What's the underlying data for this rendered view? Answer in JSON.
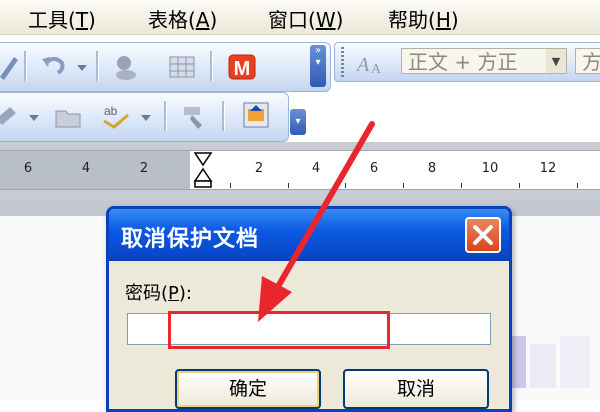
{
  "menubar": {
    "items": [
      {
        "label": "工具",
        "accel": "T"
      },
      {
        "label": "表格",
        "accel": "A"
      },
      {
        "label": "窗口",
        "accel": "W"
      },
      {
        "label": "帮助",
        "accel": "H"
      }
    ]
  },
  "format_toolbar": {
    "style_combo": "正文 + 方正",
    "font_combo": "方"
  },
  "toolbar_icons": {
    "row1": [
      "pen-icon",
      "undo-icon",
      "dropdown-icon",
      "research-icon",
      "table-icon",
      "m-icon"
    ],
    "row2": [
      "drawing-icon",
      "folder-icon",
      "spelling-icon",
      "format-painter-icon",
      "document-map-icon"
    ]
  },
  "ruler": {
    "labels": [
      "6",
      "4",
      "2",
      "2",
      "4",
      "6",
      "8",
      "10",
      "12"
    ]
  },
  "dialog": {
    "title": "取消保护文档",
    "password_label": "密码",
    "password_accel": "P",
    "password_suffix": ":",
    "password_value": "",
    "ok_label": "确定",
    "cancel_label": "取消"
  },
  "colors": {
    "titlebar": "#0c5ae3",
    "highlight": "#e8262c",
    "close_button": "#d6451d"
  }
}
